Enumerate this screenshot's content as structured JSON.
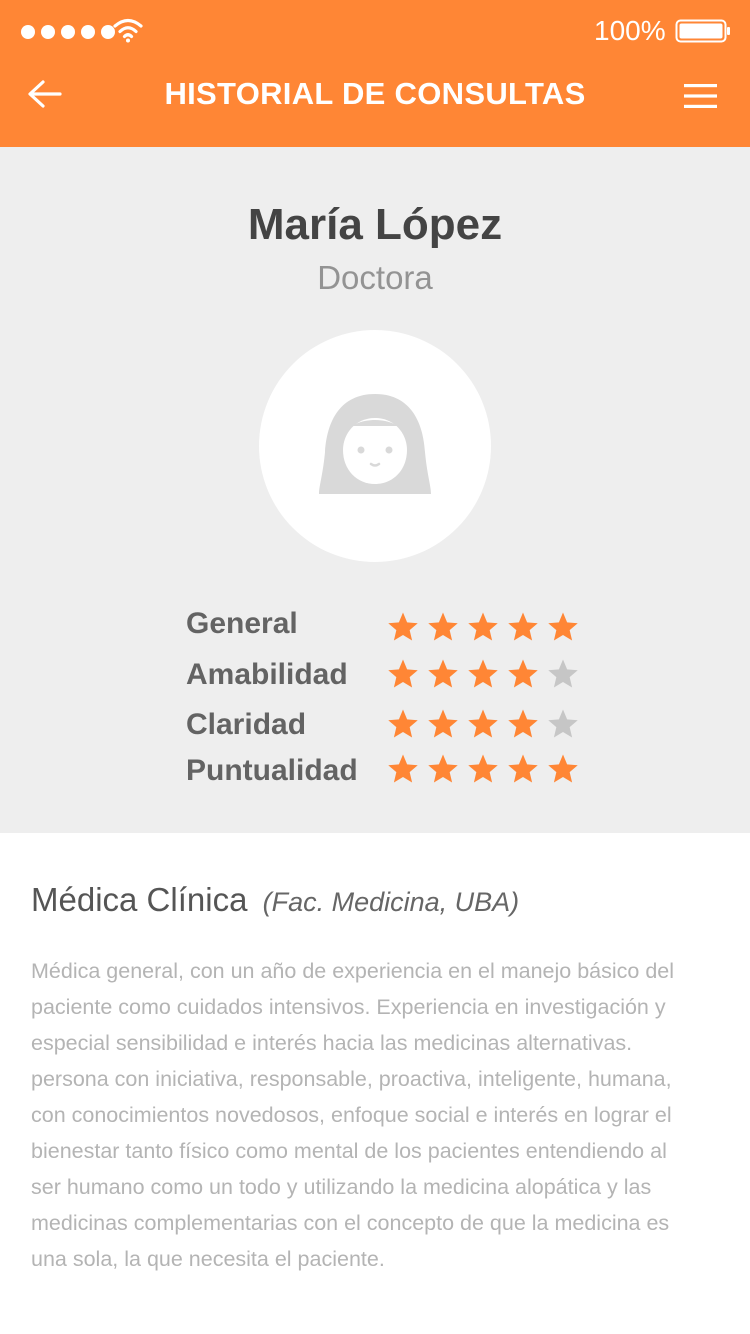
{
  "status_bar": {
    "battery_percent": "100%",
    "signal_bars": 5,
    "icons": [
      "signal-dots-icon",
      "wifi-icon",
      "battery-icon"
    ]
  },
  "header": {
    "title": "HISTORIAL DE CONSULTAS",
    "back_icon": "arrow-left-icon",
    "menu_icon": "hamburger-menu-icon",
    "background_color": "#ff8635"
  },
  "profile": {
    "name": "María López",
    "role": "Doctora",
    "avatar_icon": "female-avatar-icon",
    "ratings": [
      {
        "label": "General",
        "value": 5,
        "max": 5
      },
      {
        "label": "Amabilidad",
        "value": 4,
        "max": 5
      },
      {
        "label": "Claridad",
        "value": 4,
        "max": 5
      },
      {
        "label": "Puntualidad",
        "value": 5,
        "max": 5
      }
    ],
    "star_color_filled": "#ff8635",
    "star_color_empty": "#c6c6c6"
  },
  "details": {
    "specialty": "Médica Clínica",
    "school": "(Fac. Medicina, UBA)",
    "bio_lines": [
      "Médica general, con un año de experiencia en el manejo básico del",
      "paciente como cuidados intensivos. Experiencia en investigación y",
      "especial sensibilidad e interés hacia las medicinas alternativas.",
      "persona con iniciativa, responsable, proactiva, inteligente, humana,",
      "con conocimientos novedosos, enfoque social e interés en lograr el",
      "bienestar tanto físico como mental de los pacientes entendiendo al",
      "ser humano como un todo y utilizando la medicina alopática y las",
      "medicinas complementarias con el concepto de que la medicina es",
      "una sola, la que necesita el paciente."
    ]
  }
}
